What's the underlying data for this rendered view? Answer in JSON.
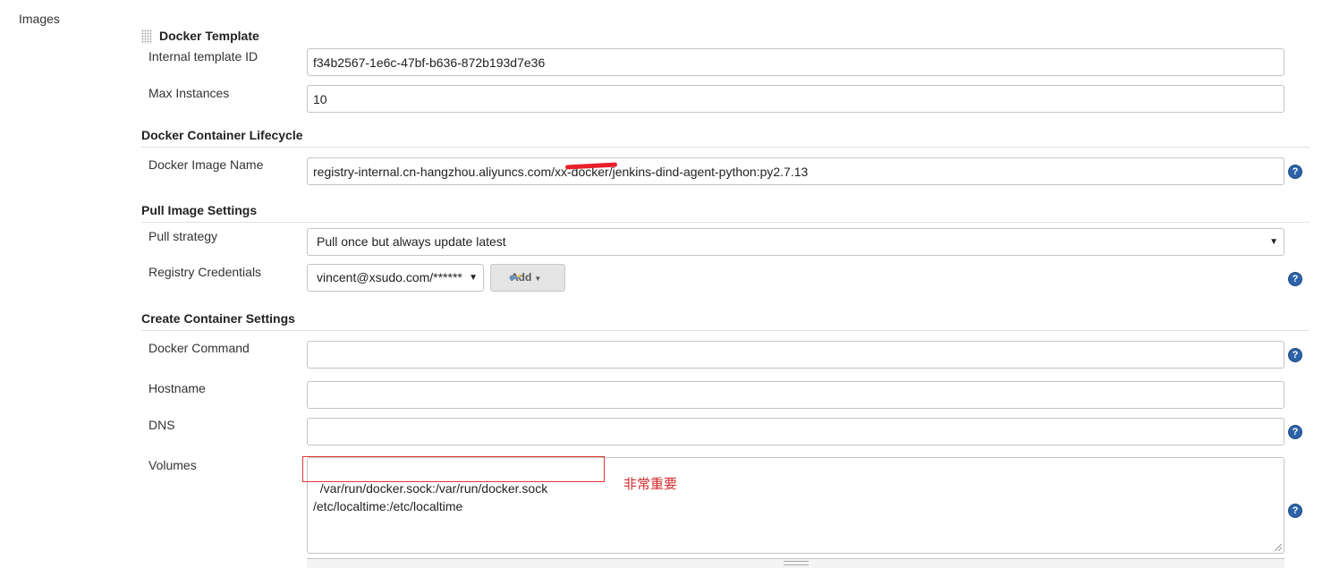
{
  "sidebar": {
    "label": "Images"
  },
  "template": {
    "title": "Docker Template"
  },
  "fields": {
    "template_id": {
      "label": "Internal template ID",
      "value": "f34b2567-1e6c-47bf-b636-872b193d7e36"
    },
    "max_instances": {
      "label": "Max Instances",
      "value": "10"
    }
  },
  "lifecycle": {
    "heading": "Docker Container Lifecycle",
    "image_name": {
      "label": "Docker Image Name",
      "value": "registry-internal.cn-hangzhou.aliyuncs.com/xx-docker/jenkins-dind-agent-python:py2.7.13"
    }
  },
  "pull": {
    "heading": "Pull Image Settings",
    "strategy": {
      "label": "Pull strategy",
      "value": "Pull once but always update latest"
    },
    "credentials": {
      "label": "Registry Credentials",
      "value": "vincent@xsudo.com/******",
      "add_label": "Add"
    }
  },
  "create": {
    "heading": "Create Container Settings",
    "command": {
      "label": "Docker Command",
      "value": ""
    },
    "hostname": {
      "label": "Hostname",
      "value": ""
    },
    "dns": {
      "label": "DNS",
      "value": ""
    },
    "volumes": {
      "label": "Volumes",
      "value": "/var/run/docker.sock:/var/run/docker.sock\n/etc/localtime:/etc/localtime"
    }
  },
  "annotation": {
    "text": "非常重要",
    "color": "#d42a2a"
  },
  "help_icon": {
    "glyph": "?"
  },
  "icons": [
    "help-icon",
    "key-icon",
    "drag-handle-icon",
    "dropdown-caret-icon"
  ]
}
